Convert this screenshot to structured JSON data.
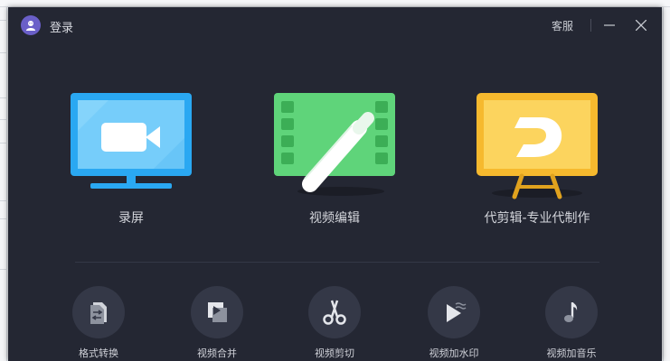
{
  "titlebar": {
    "login_label": "登录",
    "service_label": "客服",
    "avatar_icon": "user-avatar-icon",
    "minimize_icon": "minimize-icon",
    "close_icon": "close-icon"
  },
  "features": [
    {
      "label": "录屏",
      "icon": "screen-record-icon",
      "color": "#2aa8f2"
    },
    {
      "label": "视频编辑",
      "icon": "video-edit-icon",
      "color": "#5fd47a"
    },
    {
      "label": "代剪辑-专业代制作",
      "icon": "pro-editing-easel-icon",
      "color": "#f6b92e"
    }
  ],
  "tools": [
    {
      "label": "格式转换",
      "icon": "format-convert-icon"
    },
    {
      "label": "视频合并",
      "icon": "video-merge-icon"
    },
    {
      "label": "视频剪切",
      "icon": "scissors-icon"
    },
    {
      "label": "视频加水印",
      "icon": "watermark-icon"
    },
    {
      "label": "视频加音乐",
      "icon": "music-note-icon"
    }
  ],
  "colors": {
    "window_bg": "#242733",
    "tool_circle": "#343847",
    "text": "#d4d6dc"
  }
}
